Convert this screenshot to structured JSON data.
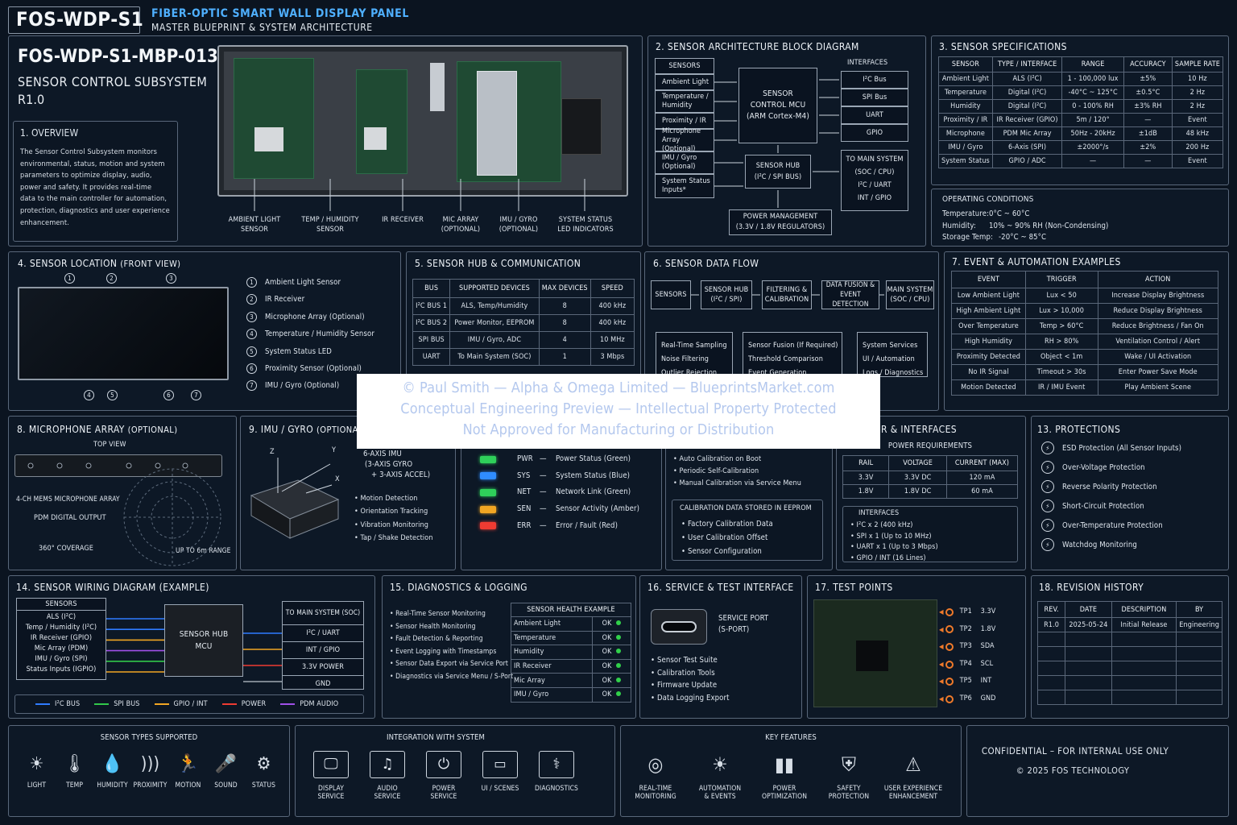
{
  "header": {
    "code": "FOS-WDP-S1",
    "title": "FIBER-OPTIC SMART WALL DISPLAY PANEL",
    "subtitle": "MASTER BLUEPRINT & SYSTEM ARCHITECTURE"
  },
  "doc": {
    "number": "FOS-WDP-S1-MBP-013",
    "name": "SENSOR CONTROL SUBSYSTEM",
    "rev": "R1.0"
  },
  "overview": {
    "title": "1.  OVERVIEW",
    "text": [
      "The Sensor Control Subsystem monitors",
      "environmental, status, motion and system",
      "parameters to optimize display, audio,",
      "power and safety. It provides real-time",
      "data to the main controller for automation,",
      "protection, diagnostics and user experience",
      "enhancement."
    ]
  },
  "board_labels": [
    [
      "AMBIENT LIGHT",
      "SENSOR"
    ],
    [
      "TEMP / HUMIDITY",
      "SENSOR"
    ],
    [
      "IR RECEIVER",
      ""
    ],
    [
      "MIC ARRAY",
      "(OPTIONAL)"
    ],
    [
      "IMU / GYRO",
      "(OPTIONAL)"
    ],
    [
      "SYSTEM STATUS",
      "LED INDICATORS"
    ]
  ],
  "block": {
    "title": "2.  SENSOR ARCHITECTURE BLOCK DIAGRAM",
    "sensors_title": "SENSORS",
    "sensors": [
      "Ambient Light",
      "Temperature / Humidity",
      "Proximity / IR",
      "Microphone Array (Optional)",
      "IMU / Gyro (Optional)",
      "System Status Inputs*"
    ],
    "mcu": [
      "SENSOR",
      "CONTROL MCU",
      "(ARM Cortex-M4)"
    ],
    "hub": [
      "SENSOR HUB",
      "(I²C / SPI BUS)"
    ],
    "interfaces_title": "INTERFACES",
    "interfaces": [
      "I²C Bus",
      "SPI Bus",
      "UART",
      "GPIO"
    ],
    "main": [
      "TO MAIN SYSTEM",
      "(SOC / CPU)",
      "I²C / UART",
      "INT / GPIO"
    ],
    "power": [
      "POWER MANAGEMENT",
      "(3.3V / 1.8V REGULATORS)"
    ]
  },
  "specs": {
    "title": "3.  SENSOR SPECIFICATIONS",
    "headers": [
      "SENSOR",
      "TYPE / INTERFACE",
      "RANGE",
      "ACCURACY",
      "SAMPLE RATE"
    ],
    "rows": [
      [
        "Ambient Light",
        "ALS (I²C)",
        "1 - 100,000 lux",
        "±5%",
        "10 Hz"
      ],
      [
        "Temperature",
        "Digital (I²C)",
        "-40°C ~ 125°C",
        "±0.5°C",
        "2 Hz"
      ],
      [
        "Humidity",
        "Digital (I²C)",
        "0 - 100% RH",
        "±3% RH",
        "2 Hz"
      ],
      [
        "Proximity / IR",
        "IR Receiver (GPIO)",
        "5m / 120°",
        "—",
        "Event"
      ],
      [
        "Microphone",
        "PDM Mic Array",
        "50Hz - 20kHz",
        "±1dB",
        "48 kHz"
      ],
      [
        "IMU / Gyro",
        "6-Axis (SPI)",
        "±2000°/s",
        "±2%",
        "200 Hz"
      ],
      [
        "System Status",
        "GPIO / ADC",
        "—",
        "—",
        "Event"
      ]
    ]
  },
  "operating": {
    "title": "OPERATING CONDITIONS",
    "rows": [
      [
        "Temperature:",
        "0°C ~ 60°C"
      ],
      [
        "Humidity:",
        "10% ~ 90% RH (Non-Condensing)"
      ],
      [
        "Storage Temp:",
        "-20°C ~ 85°C"
      ]
    ]
  },
  "location": {
    "title": "4.  SENSOR LOCATION",
    "title_suffix": "(FRONT VIEW)",
    "items": [
      "Ambient Light Sensor",
      "IR Receiver",
      "Microphone Array (Optional)",
      "Temperature / Humidity Sensor",
      "System Status LED",
      "Proximity Sensor (Optional)",
      "IMU / Gyro (Optional)"
    ],
    "top_marks": [
      "1",
      "2",
      "3"
    ],
    "bottom_marks": [
      "4",
      "5",
      "6",
      "7"
    ]
  },
  "hub": {
    "title": "5.  SENSOR HUB & COMMUNICATION",
    "headers": [
      "BUS",
      "SUPPORTED DEVICES",
      "MAX DEVICES",
      "SPEED"
    ],
    "rows": [
      [
        "I²C BUS 1",
        "ALS, Temp/Humidity",
        "8",
        "400 kHz"
      ],
      [
        "I²C BUS 2",
        "Power Monitor, EEPROM",
        "8",
        "400 kHz"
      ],
      [
        "SPI BUS",
        "IMU / Gyro, ADC",
        "4",
        "10 MHz"
      ],
      [
        "UART",
        "To Main System (SOC)",
        "1",
        "3 Mbps"
      ]
    ]
  },
  "flow": {
    "title": "6.  SENSOR DATA FLOW",
    "steps": [
      [
        "SENSORS"
      ],
      [
        "SENSOR HUB",
        "(I²C / SPI)"
      ],
      [
        "FILTERING &",
        "CALIBRATION"
      ],
      [
        "DATA FUSION &",
        "EVENT DETECTION"
      ],
      [
        "MAIN SYSTEM",
        "(SOC / CPU)"
      ]
    ],
    "notes": [
      [
        "Real-Time Sampling",
        "Noise Filtering",
        "Outlier Rejection"
      ],
      [
        "Sensor Fusion (If Required)",
        "Threshold Comparison",
        "Event Generation"
      ],
      [
        "System Services",
        "UI / Automation",
        "Logs / Diagnostics"
      ]
    ]
  },
  "events": {
    "title": "7.  EVENT & AUTOMATION EXAMPLES",
    "headers": [
      "EVENT",
      "TRIGGER",
      "ACTION"
    ],
    "rows": [
      [
        "Low Ambient Light",
        "Lux < 50",
        "Increase Display Brightness"
      ],
      [
        "High Ambient Light",
        "Lux > 10,000",
        "Reduce Display Brightness"
      ],
      [
        "Over Temperature",
        "Temp > 60°C",
        "Reduce Brightness / Fan On"
      ],
      [
        "High Humidity",
        "RH > 80%",
        "Ventilation Control / Alert"
      ],
      [
        "Proximity Detected",
        "Object < 1m",
        "Wake / UI Activation"
      ],
      [
        "No IR Signal",
        "Timeout > 30s",
        "Enter Power Save Mode"
      ],
      [
        "Motion Detected",
        "IR / IMU Event",
        "Play Ambient Scene"
      ]
    ]
  },
  "mic": {
    "title": "8.  MICROPHONE ARRAY",
    "title_suffix": "(OPTIONAL)",
    "top_view": "TOP VIEW",
    "array": "4-CH MEMS MICROPHONE ARRAY",
    "pdm": "PDM DIGITAL OUTPUT",
    "coverage": "360° COVERAGE",
    "range": "UP TO 6m RANGE"
  },
  "imu": {
    "title": "9.  IMU / GYRO",
    "title_suffix": "(OPTIONAL)",
    "axes": [
      "Z",
      "Y",
      "X"
    ],
    "desc": [
      "6-AXIS IMU",
      "(3-AXIS GYRO",
      "+ 3-AXIS ACCEL)"
    ],
    "features": [
      "Motion Detection",
      "Orientation Tracking",
      "Vibration Monitoring",
      "Tap / Shake Detection"
    ]
  },
  "leds": {
    "items": [
      {
        "code": "PWR",
        "label": "Power Status (Green)",
        "color": "#2fd05a"
      },
      {
        "code": "SYS",
        "label": "System Status (Blue)",
        "color": "#2f8cff"
      },
      {
        "code": "NET",
        "label": "Network Link (Green)",
        "color": "#2fd05a"
      },
      {
        "code": "SEN",
        "label": "Sensor Activity (Amber)",
        "color": "#f2a623"
      },
      {
        "code": "ERR",
        "label": "Error / Fault (Red)",
        "color": "#ef3b32"
      }
    ]
  },
  "calib": {
    "items": [
      "Auto Calibration on Boot",
      "Periodic Self-Calibration",
      "Manual Calibration via Service Menu"
    ],
    "stored_title": "CALIBRATION DATA STORED IN EEPROM",
    "stored": [
      "Factory Calibration Data",
      "User Calibration Offset",
      "Sensor Configuration"
    ]
  },
  "power": {
    "title_visible": "R & INTERFACES",
    "req_title": "POWER REQUIREMENTS",
    "headers": [
      "RAIL",
      "VOLTAGE",
      "CURRENT (MAX)"
    ],
    "rows": [
      [
        "3.3V",
        "3.3V DC",
        "120 mA"
      ],
      [
        "1.8V",
        "1.8V DC",
        "60 mA"
      ]
    ],
    "if_title": "INTERFACES",
    "interfaces": [
      "I²C x 2 (400 kHz)",
      "SPI x 1 (Up to 10 MHz)",
      "UART x 1 (Up to 3 Mbps)",
      "GPIO / INT (16 Lines)"
    ]
  },
  "protections": {
    "title": "13.  PROTECTIONS",
    "items": [
      "ESD Protection (All Sensor Inputs)",
      "Over-Voltage Protection",
      "Reverse Polarity Protection",
      "Short-Circuit Protection",
      "Over-Temperature Protection",
      "Watchdog Monitoring"
    ]
  },
  "wiring": {
    "title": "14.  SENSOR WIRING DIAGRAM (EXAMPLE)",
    "sensors_title": "SENSORS",
    "sensors": [
      "ALS (I²C)",
      "Temp / Humidity (I²C)",
      "IR Receiver (GPIO)",
      "Mic Array (PDM)",
      "IMU / Gyro (SPI)",
      "Status Inputs (IGPIO)"
    ],
    "hub": [
      "SENSOR HUB",
      "MCU"
    ],
    "main_title": "TO MAIN SYSTEM (SOC)",
    "main": [
      "I²C / UART",
      "INT / GPIO",
      "3.3V  POWER",
      "GND"
    ],
    "legend": [
      {
        "label": "I²C BUS",
        "color": "#2f7bff"
      },
      {
        "label": "SPI BUS",
        "color": "#31c84a"
      },
      {
        "label": "GPIO / INT",
        "color": "#f2a623"
      },
      {
        "label": "POWER",
        "color": "#ef3b32"
      },
      {
        "label": "PDM AUDIO",
        "color": "#a050e8"
      }
    ]
  },
  "diag": {
    "title": "15.  DIAGNOSTICS & LOGGING",
    "items": [
      "Real-Time Sensor Monitoring",
      "Sensor Health Monitoring",
      "Fault Detection & Reporting",
      "Event Logging with Timestamps",
      "Sensor Data Export via Service Port",
      "Diagnostics via Service Menu / S-Port"
    ],
    "health_title": "SENSOR HEALTH EXAMPLE",
    "health": [
      [
        "Ambient Light",
        "OK"
      ],
      [
        "Temperature",
        "OK"
      ],
      [
        "Humidity",
        "OK"
      ],
      [
        "IR Receiver",
        "OK"
      ],
      [
        "Mic Array",
        "OK"
      ],
      [
        "IMU / Gyro",
        "OK"
      ]
    ]
  },
  "service": {
    "title": "16.  SERVICE & TEST INTERFACE",
    "port": [
      "SERVICE PORT",
      "(S-PORT)"
    ],
    "items": [
      "Sensor Test Suite",
      "Calibration Tools",
      "Firmware Update",
      "Data Logging Export"
    ]
  },
  "tests": {
    "title": "17.  TEST POINTS",
    "points": [
      [
        "TP1",
        "3.3V"
      ],
      [
        "TP2",
        "1.8V"
      ],
      [
        "TP3",
        "SDA"
      ],
      [
        "TP4",
        "SCL"
      ],
      [
        "TP5",
        "INT"
      ],
      [
        "TP6",
        "GND"
      ]
    ]
  },
  "revision": {
    "title": "18.  REVISION HISTORY",
    "headers": [
      "REV.",
      "DATE",
      "DESCRIPTION",
      "BY"
    ],
    "rows": [
      [
        "R1.0",
        "2025-05-24",
        "Initial Release",
        "Engineering"
      ]
    ]
  },
  "footer": {
    "types_title": "SENSOR TYPES SUPPORTED",
    "types": [
      {
        "label": "LIGHT",
        "icon": "light-icon"
      },
      {
        "label": "TEMP",
        "icon": "thermometer-icon"
      },
      {
        "label": "HUMIDITY",
        "icon": "humidity-icon"
      },
      {
        "label": "PROXIMITY",
        "icon": "proximity-icon"
      },
      {
        "label": "MOTION",
        "icon": "motion-icon"
      },
      {
        "label": "SOUND",
        "icon": "sound-icon"
      },
      {
        "label": "STATUS",
        "icon": "status-icon"
      }
    ],
    "integration_title": "INTEGRATION WITH SYSTEM",
    "integration": [
      [
        "DISPLAY",
        "SERVICE"
      ],
      [
        "AUDIO",
        "SERVICE"
      ],
      [
        "POWER",
        "SERVICE"
      ],
      [
        "UI / SCENES",
        ""
      ],
      [
        "DIAGNOSTICS",
        ""
      ]
    ],
    "features_title": "KEY FEATURES",
    "features": [
      [
        "REAL-TIME",
        "MONITORING"
      ],
      [
        "AUTOMATION",
        "& EVENTS"
      ],
      [
        "POWER",
        "OPTIMIZATION"
      ],
      [
        "SAFETY",
        "PROTECTION"
      ],
      [
        "USER EXPERIENCE",
        "ENHANCEMENT"
      ]
    ],
    "confidential": "CONFIDENTIAL – FOR INTERNAL USE ONLY",
    "copyright": "© 2025 FOS TECHNOLOGY"
  },
  "watermark": [
    "© Paul Smith — Alpha & Omega Limited — BlueprintsMarket.com",
    "Conceptual Engineering Preview — Intellectual Property Protected",
    "Not Approved for Manufacturing or Distribution"
  ]
}
